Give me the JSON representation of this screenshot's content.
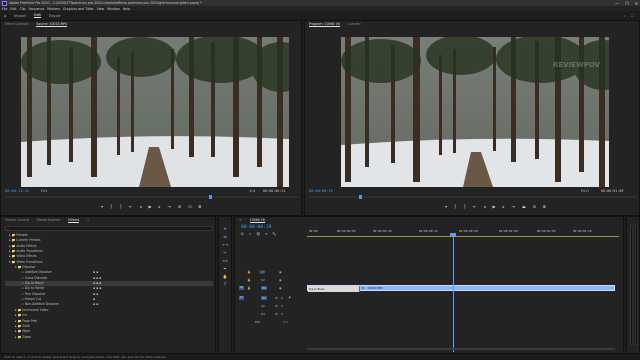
{
  "app": {
    "title": "Adobe Premiere Pro 2020 - C:\\2020\\STTspectrum-pro-2020-tutorial\\effects-premiere-pro-2020\\glitch\\sound-glitch.prproj *",
    "window_controls": [
      "—",
      "❐",
      "✕"
    ]
  },
  "menu": [
    "File",
    "Edit",
    "Clip",
    "Sequence",
    "Markers",
    "Graphics and Titles",
    "View",
    "Window",
    "Help"
  ],
  "workspaces": {
    "items": [
      "Import",
      "Edit",
      "Export"
    ],
    "active": "Edit"
  },
  "source_panel": {
    "tabs": [
      "Effect Controls",
      "Source: 10015.MP4"
    ],
    "timecode_in": "00:00:14:22",
    "fit": "Fit",
    "page": "1/4",
    "timecode_dur": "00:00:00:12"
  },
  "program_panel": {
    "tabs": [
      "Program: 10060 (9)",
      "Lumetri"
    ],
    "timecode_in": "00:00:00:19",
    "fit": "Full",
    "timecode_dur": "00:00:01:09",
    "watermark": "REVIEWPOV"
  },
  "project_panel": {
    "tabs": [
      "Project: Unseld",
      "Media Browser",
      "Effects",
      "»"
    ],
    "search_placeholder": "",
    "effects": [
      {
        "label": "Presets",
        "level": 0
      },
      {
        "label": "Lumetri Presets",
        "level": 0
      },
      {
        "label": "Audio Effects",
        "level": 0
      },
      {
        "label": "Audio Transitions",
        "level": 0
      },
      {
        "label": "Video Effects",
        "level": 0
      },
      {
        "label": "Video Transitions",
        "level": 0
      },
      {
        "label": "Dissolve",
        "level": 1
      },
      {
        "label": "Additive Dissolve",
        "level": 2
      },
      {
        "label": "Cross Dissolve",
        "level": 2
      },
      {
        "label": "Dip to Black",
        "level": 2,
        "selected": true
      },
      {
        "label": "Dip to White",
        "level": 2
      },
      {
        "label": "Film Dissolve",
        "level": 2
      },
      {
        "label": "Morph Cut",
        "level": 2
      },
      {
        "label": "Non-Additive Dissolve",
        "level": 2
      },
      {
        "label": "Immersive Video",
        "level": 1
      },
      {
        "label": "Iris",
        "level": 1
      },
      {
        "label": "Page Peel",
        "level": 1
      },
      {
        "label": "Slide",
        "level": 1
      },
      {
        "label": "Wipe",
        "level": 1
      },
      {
        "label": "Zoom",
        "level": 1
      }
    ]
  },
  "timeline": {
    "tab": "10060 (9)",
    "timecode": "00:00:00:19",
    "ruler": [
      "00:00",
      "00:00:00:05",
      "00:00:00:10",
      "00:00:00:15",
      "00:00:00:20",
      "00:00:01:00",
      "00:00:01:05",
      "00:00:01:10"
    ],
    "tracks": [
      "V3",
      "V2",
      "V1",
      "A1",
      "A2",
      "A3",
      "Mix"
    ],
    "clip_transition_label": "Dip to Black",
    "clip_label": "10015.MP4",
    "mix_value": "0.0"
  },
  "status_bar": "Click to select, or click in empty space and drag to marquee select. Use Shift, Alt, and Ctrl for other options.",
  "colors": {
    "accent_blue": "#3ea0ff",
    "clip_blue": "#8bb4ff",
    "playhead": "#5a9cff"
  }
}
